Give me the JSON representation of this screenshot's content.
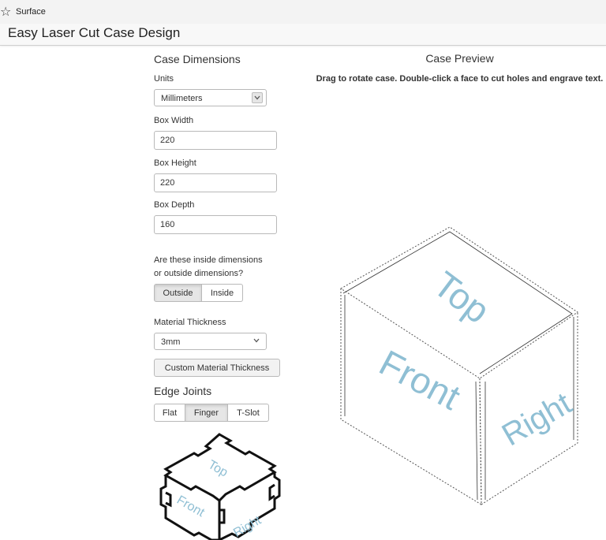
{
  "window": {
    "title": "Surface",
    "icon": "star-icon"
  },
  "app": {
    "title": "Easy Laser Cut Case Design"
  },
  "dimensions": {
    "heading": "Case Dimensions",
    "units_label": "Units",
    "units_value": "Millimeters",
    "width_label": "Box Width",
    "width_value": "220",
    "height_label": "Box Height",
    "height_value": "220",
    "depth_label": "Box Depth",
    "depth_value": "160",
    "io_question_line1": "Are these inside dimensions",
    "io_question_line2": "or outside dimensions?",
    "io_options": [
      "Outside",
      "Inside"
    ],
    "io_selected": "Outside",
    "thickness_label": "Material Thickness",
    "thickness_value": "3mm",
    "custom_thickness_label": "Custom Material Thickness"
  },
  "edge_joints": {
    "heading": "Edge Joints",
    "options": [
      "Flat",
      "Finger",
      "T-Slot"
    ],
    "selected": "Finger"
  },
  "joint_thumbnail": {
    "faces": [
      "Top",
      "Front",
      "Right"
    ]
  },
  "preview": {
    "heading": "Case Preview",
    "help": "Drag to rotate case. Double-click a face to cut holes and engrave text.",
    "faces": [
      "Top",
      "Front",
      "Right"
    ]
  },
  "colors": {
    "face_label": "#8fbfd4",
    "active_button": "#e6e6e6",
    "edge_line": "#444444"
  }
}
